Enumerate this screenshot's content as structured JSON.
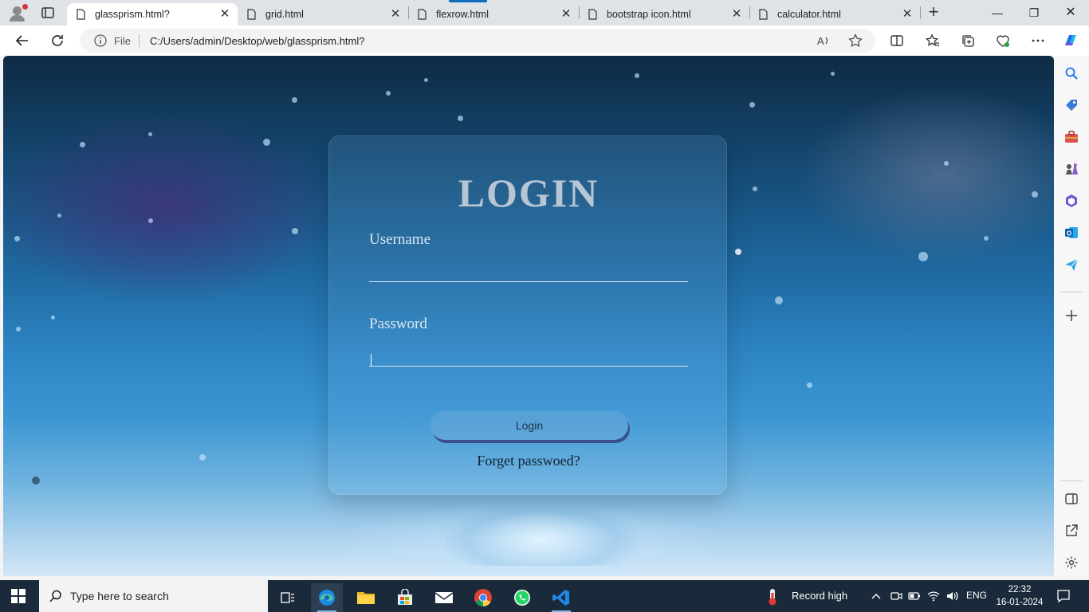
{
  "browser": {
    "tabs": [
      {
        "title": "glassprism.html?",
        "active": true
      },
      {
        "title": "grid.html",
        "active": false
      },
      {
        "title": "flexrow.html",
        "active": false
      },
      {
        "title": "bootstrap icon.html",
        "active": false
      },
      {
        "title": "calculator.html",
        "active": false
      }
    ],
    "address": {
      "scheme_label": "File",
      "url": "C:/Users/admin/Desktop/web/glassprism.html?"
    }
  },
  "page": {
    "title": "LOGIN",
    "username_label": "Username",
    "username_value": "",
    "password_label": "Password",
    "password_value": "",
    "login_button": "Login",
    "forgot_link": "Forget passwoed?"
  },
  "taskbar": {
    "search_placeholder": "Type here to search",
    "weather_text": "Record high",
    "language": "ENG",
    "time": "22:32",
    "date": "16-01-2024"
  },
  "colors": {
    "accent": "#0f6cbd",
    "login_button_shadow": "#3a4f8c",
    "taskbar": "#1b2a3a"
  }
}
